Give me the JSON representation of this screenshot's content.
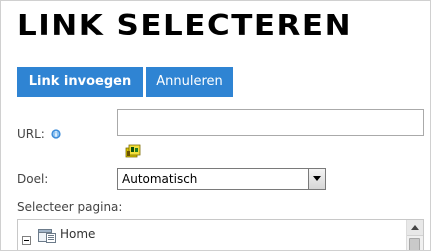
{
  "dialog": {
    "title": "LINK SELECTEREN"
  },
  "toolbar": {
    "insert_label": "Link invoegen",
    "cancel_label": "Annuleren"
  },
  "form": {
    "url_label": "URL:",
    "url_value": "",
    "target_label": "Doel:",
    "target_selected": "Automatisch",
    "page_label": "Selecteer pagina:"
  },
  "tree": {
    "items": [
      {
        "label": "Home",
        "expanded": true,
        "icon": "page-icon"
      }
    ]
  },
  "icons": {
    "info": "info-icon",
    "browse": "folder-icon",
    "dropdown": "chevron-down-icon",
    "toggle": "collapse-icon",
    "scroll_up": "chevron-up-icon"
  },
  "colors": {
    "button": "#2f84d3",
    "button_text": "#ffffff",
    "info": "#3a8ad8",
    "folder": "#d8c400"
  }
}
